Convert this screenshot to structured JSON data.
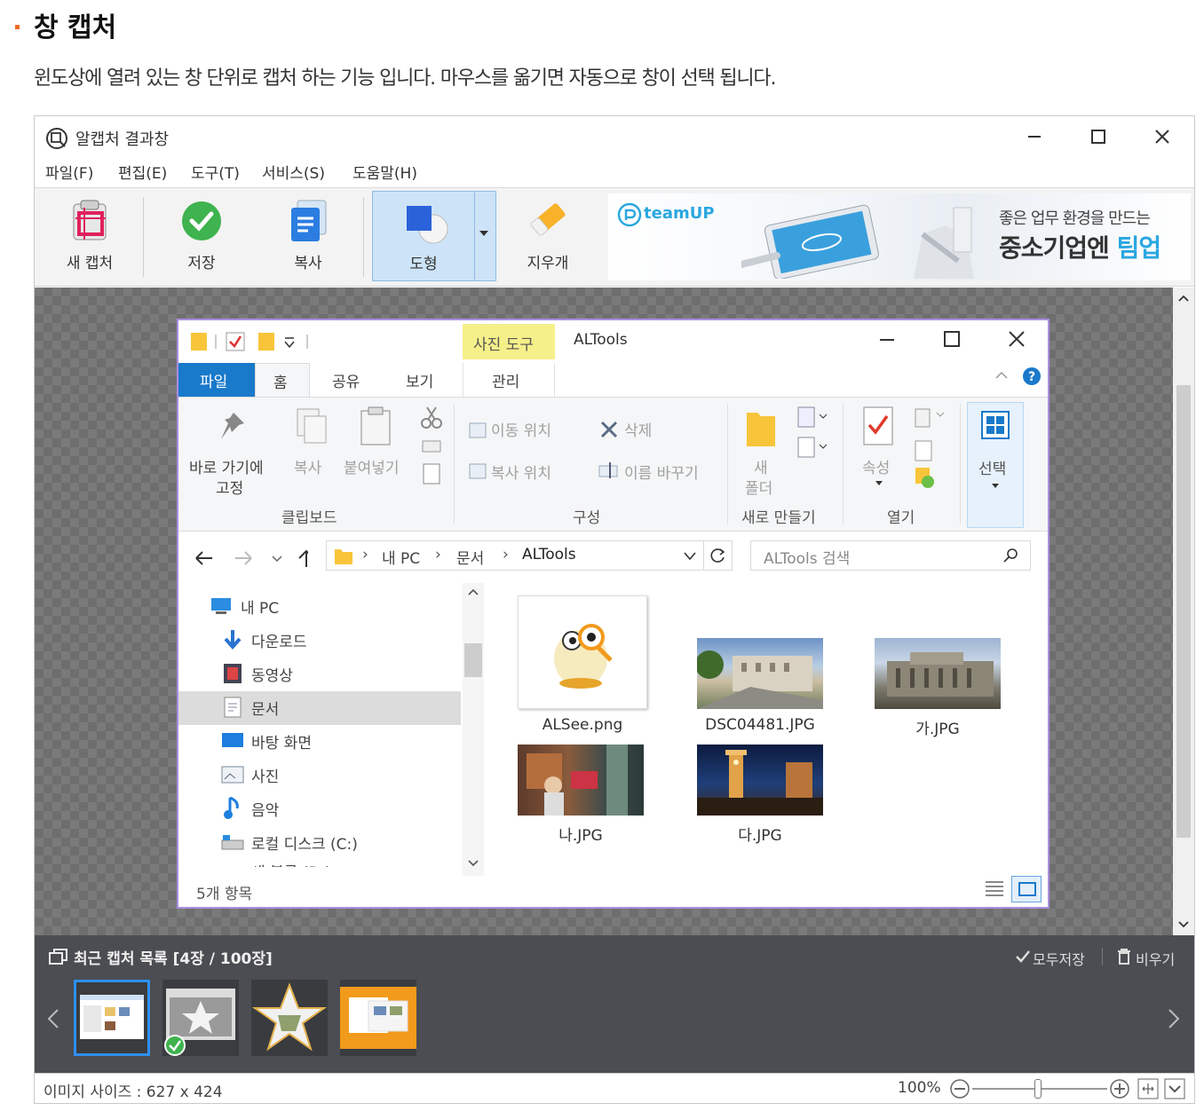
{
  "page": {
    "heading": "창 캡처",
    "description": "윈도상에 열려 있는 창 단위로 캡처 하는 기능 입니다. 마우스를 옮기면 자동으로 창이 선택 됩니다."
  },
  "app": {
    "title": "알캡처 결과창",
    "menu": [
      "파일(F)",
      "편집(E)",
      "도구(T)",
      "서비스(S)",
      "도움말(H)"
    ],
    "toolbar": {
      "new_capture": "새 캡처",
      "save": "저장",
      "copy": "복사",
      "shape": "도형",
      "eraser": "지우개"
    },
    "ad": {
      "brand": "teamUP",
      "line1": "좋은 업무 환경을 만드는",
      "line2_prefix": "중소기업엔 ",
      "line2_highlight": "팀업"
    },
    "recent": {
      "title": "최근 캡처 목록 [4장 / 100장]",
      "save_all": "모두저장",
      "clear": "비우기"
    },
    "status": {
      "image_size": "이미지 사이즈 : 627 x 424",
      "zoom": "100%"
    }
  },
  "explorer": {
    "context_tab": "사진 도구",
    "title": "ALTools",
    "tabs": [
      "파일",
      "홈",
      "공유",
      "보기"
    ],
    "context_sub": "관리",
    "ribbon": {
      "pin": "바로 가기에",
      "pin2": "고정",
      "copy": "복사",
      "paste": "붙여넣기",
      "move_to": "이동 위치",
      "copy_to": "복사 위치",
      "delete": "삭제",
      "rename": "이름 바꾸기",
      "new_folder1": "새",
      "new_folder2": "폴더",
      "properties": "속성",
      "select": "선택",
      "groups": [
        "클립보드",
        "구성",
        "새로 만들기",
        "열기"
      ]
    },
    "address": {
      "crumbs": [
        "내 PC",
        "문서",
        "ALTools"
      ],
      "search_placeholder": "ALTools 검색"
    },
    "nav": [
      "내 PC",
      "다운로드",
      "동영상",
      "문서",
      "바탕 화면",
      "사진",
      "음악",
      "로컬 디스크 (C:)",
      "새 볼륨 (D:)"
    ],
    "files": [
      "ALSee.png",
      "DSC04481.JPG",
      "가.JPG",
      "나.JPG",
      "다.JPG"
    ],
    "item_count": "5개 항목"
  },
  "colors": {
    "accent_orange": "#f06b21",
    "selection_purple": "#a98ee0",
    "file_tab_blue": "#1979ca",
    "context_yellow": "#f6f08a",
    "recent_bg": "#4b4d52",
    "teamup_blue": "#2aa7e0"
  }
}
